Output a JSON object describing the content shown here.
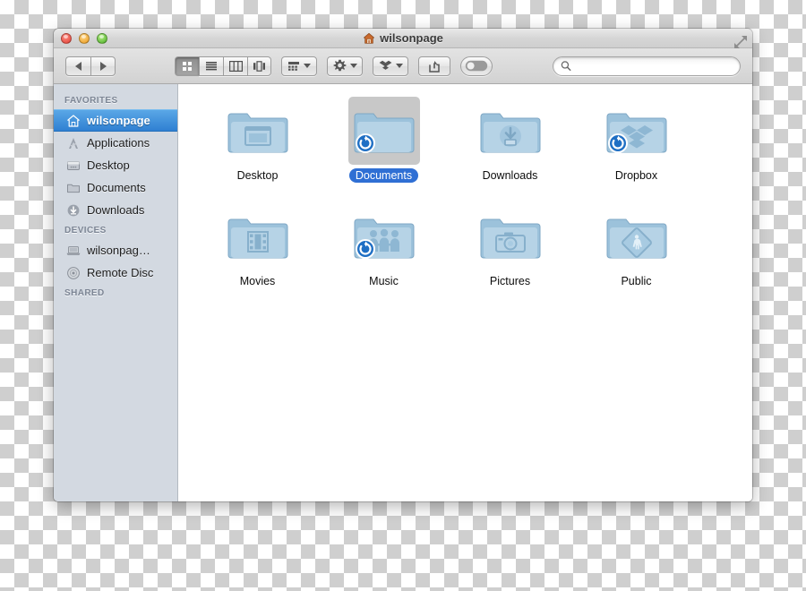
{
  "window": {
    "title": "wilsonpage",
    "title_icon": "home-icon",
    "controls": {
      "close": "close-button",
      "minimize": "minimize-button",
      "zoom": "zoom-button"
    },
    "fullscreen_icon": "fullscreen-expand-icon"
  },
  "toolbar": {
    "back_label": "Back",
    "forward_label": "Forward",
    "views": [
      {
        "name": "icon-view",
        "label": "Icon View",
        "selected": true
      },
      {
        "name": "list-view",
        "label": "List View",
        "selected": false
      },
      {
        "name": "column-view",
        "label": "Column View",
        "selected": false
      },
      {
        "name": "coverflow-view",
        "label": "Cover Flow View",
        "selected": false
      }
    ],
    "arrange_label": "Arrange",
    "action_label": "Action",
    "dropbox_label": "Dropbox",
    "share_label": "Share",
    "tags_label": "Tags"
  },
  "search": {
    "value": "",
    "placeholder": "",
    "icon": "search-icon"
  },
  "sidebar": {
    "sections": [
      {
        "header": "FAVORITES",
        "items": [
          {
            "label": "wilsonpage",
            "icon": "home-icon",
            "selected": true
          },
          {
            "label": "Applications",
            "icon": "applications-icon",
            "selected": false
          },
          {
            "label": "Desktop",
            "icon": "desktop-icon",
            "selected": false
          },
          {
            "label": "Documents",
            "icon": "folder-icon",
            "selected": false
          },
          {
            "label": "Downloads",
            "icon": "downloads-icon",
            "selected": false
          }
        ]
      },
      {
        "header": "DEVICES",
        "items": [
          {
            "label": "wilsonpag…",
            "icon": "laptop-icon",
            "selected": false
          },
          {
            "label": "Remote Disc",
            "icon": "disc-icon",
            "selected": false
          }
        ]
      },
      {
        "header": "SHARED",
        "items": []
      }
    ]
  },
  "content": {
    "items": [
      {
        "label": "Desktop",
        "glyph": "desktop-window-glyph",
        "badge": null,
        "selected": false
      },
      {
        "label": "Documents",
        "glyph": null,
        "badge": "sync-badge",
        "selected": true
      },
      {
        "label": "Downloads",
        "glyph": "download-arrow-glyph",
        "badge": null,
        "selected": false
      },
      {
        "label": "Dropbox",
        "glyph": "dropbox-glyph",
        "badge": "sync-badge",
        "selected": false
      },
      {
        "label": "Movies",
        "glyph": "film-strip-glyph",
        "badge": null,
        "selected": false
      },
      {
        "label": "Music",
        "glyph": "people-glyph",
        "badge": "sync-badge",
        "selected": false
      },
      {
        "label": "Pictures",
        "glyph": "camera-glyph",
        "badge": null,
        "selected": false
      },
      {
        "label": "Public",
        "glyph": "pedestrian-sign-glyph",
        "badge": null,
        "selected": false
      }
    ]
  },
  "colors": {
    "selection_blue": "#2f6fd4",
    "sidebar_bg": "#d3d9e1",
    "sidebar_selection": "#2f80d2",
    "folder_blue": "#8fb9d8",
    "content_bg": "#ffffff"
  }
}
